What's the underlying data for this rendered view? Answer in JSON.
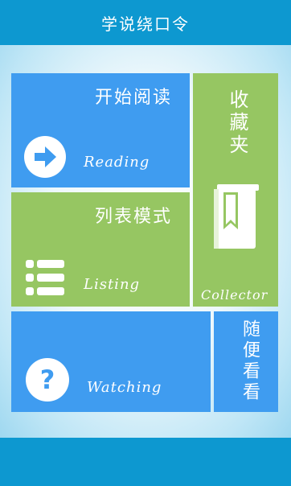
{
  "app": {
    "title": "学说绕口令"
  },
  "tiles": {
    "reading": {
      "label": "开始阅读",
      "sublabel": "Reading",
      "icon": "arrow-right-circle-icon"
    },
    "listing": {
      "label": "列表模式",
      "sublabel": "Listing",
      "icon": "list-icon"
    },
    "collector": {
      "label": "收藏夹",
      "sublabel": "Collector",
      "icon": "bookmark-book-icon"
    },
    "watching": {
      "label": "",
      "sublabel": "Watching",
      "icon": "question-circle-icon"
    },
    "random": {
      "label": "随便看看"
    }
  },
  "colors": {
    "bar": "#0d98d0",
    "blue_tile": "#3f9cf0",
    "green_tile": "#96c662"
  }
}
